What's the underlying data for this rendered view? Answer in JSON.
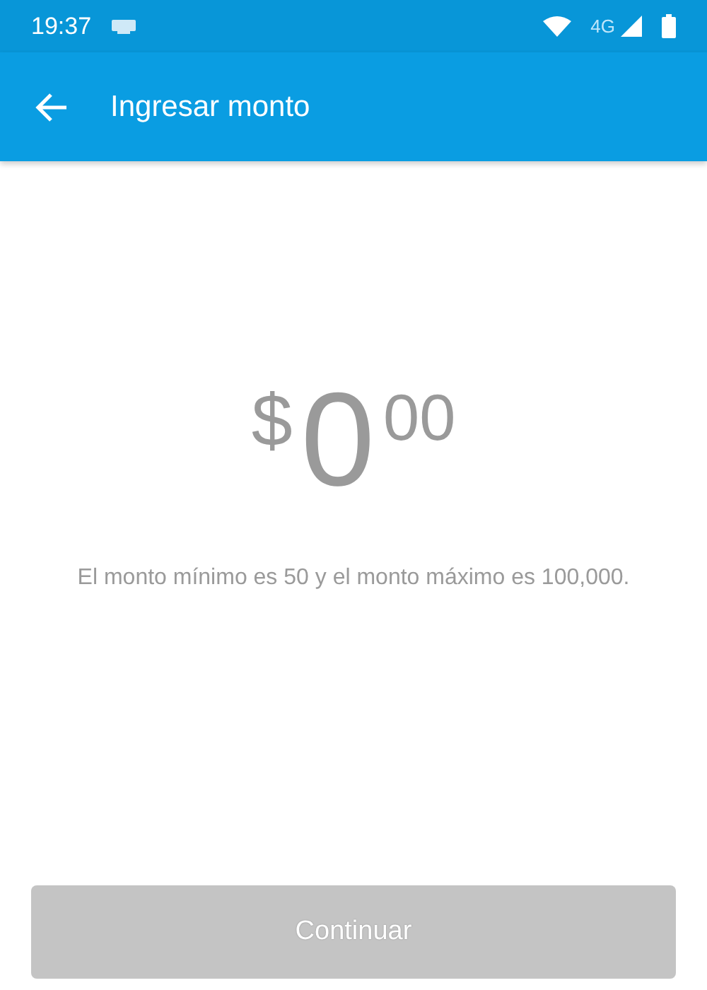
{
  "status_bar": {
    "time": "19:37",
    "network": "4G"
  },
  "app_bar": {
    "title": "Ingresar monto"
  },
  "amount": {
    "currency": "$",
    "integer": "0",
    "cents": "00"
  },
  "hint": "El monto mínimo es 50 y el monto máximo es 100,000.",
  "continue_button": {
    "label": "Continuar",
    "disabled": true
  }
}
